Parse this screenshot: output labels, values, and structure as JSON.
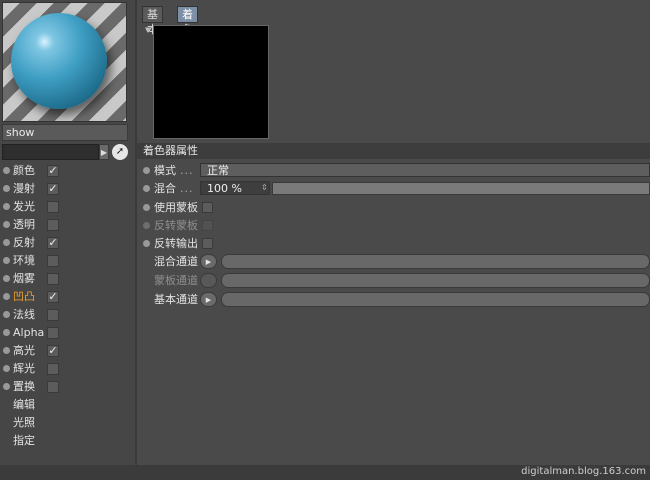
{
  "material": {
    "name": "show"
  },
  "channels": [
    {
      "label": "颜色",
      "checked": true,
      "active": false
    },
    {
      "label": "漫射",
      "checked": true,
      "active": false
    },
    {
      "label": "发光",
      "checked": false,
      "active": false
    },
    {
      "label": "透明",
      "checked": false,
      "active": false
    },
    {
      "label": "反射",
      "checked": true,
      "active": false
    },
    {
      "label": "环境",
      "checked": false,
      "active": false
    },
    {
      "label": "烟雾",
      "checked": false,
      "active": false
    },
    {
      "label": "凹凸",
      "checked": true,
      "active": true
    },
    {
      "label": "法线",
      "checked": false,
      "active": false
    },
    {
      "label": "Alpha",
      "checked": false,
      "active": false
    },
    {
      "label": "高光",
      "checked": true,
      "active": false
    },
    {
      "label": "辉光",
      "checked": false,
      "active": false
    },
    {
      "label": "置换",
      "checked": false,
      "active": false
    }
  ],
  "extra_items": [
    "编辑",
    "光照",
    "指定"
  ],
  "tabs": [
    {
      "label": "基本",
      "selected": false
    },
    {
      "label": "着色器",
      "selected": true
    }
  ],
  "section_title": "着色器属性",
  "properties": {
    "mode_label": "模式",
    "mode_dots": "...",
    "mode_value": "正常",
    "blend_label": "混合",
    "blend_dots": "...",
    "blend_value": "100 %",
    "use_mask_label": "使用蒙板",
    "invert_mask_label": "反转蒙板",
    "invert_output_label": "反转输出",
    "blend_channel_label": "混合通道",
    "mask_channel_label": "蒙板通道",
    "base_channel_label": "基本通道"
  },
  "check_glyph": "✓",
  "arrow_glyph": "▶",
  "icons": {
    "preview_menu": "triangle-down-icon",
    "picker": "cursor-pick-icon"
  },
  "watermark": "digitalman.blog.163.com"
}
